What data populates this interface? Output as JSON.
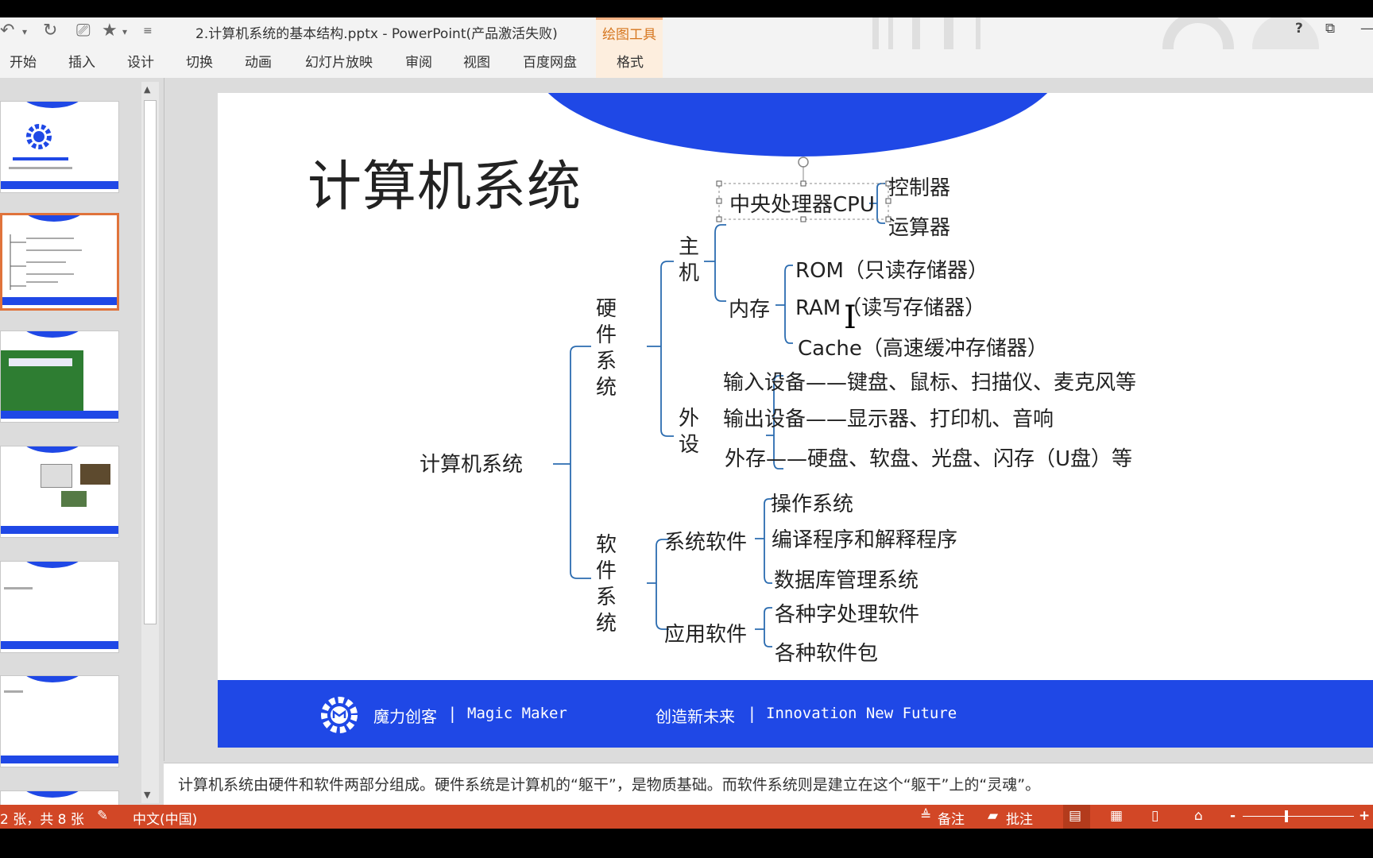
{
  "window": {
    "title": "2.计算机系统的基本结构.pptx - PowerPoint(产品激活失败)",
    "contextual_group": "绘图工具",
    "help": "?"
  },
  "ribbon": {
    "tabs": [
      "开始",
      "插入",
      "设计",
      "切换",
      "动画",
      "幻灯片放映",
      "审阅",
      "视图",
      "百度网盘"
    ],
    "contextual_tab": "格式"
  },
  "slide": {
    "title": "计算机系统",
    "tree": {
      "root": "计算机系统",
      "hardware": "硬件系统",
      "host": "主机",
      "cpu": "中央处理器CPU",
      "controller": "控制器",
      "alu": "运算器",
      "memory": "内存",
      "rom": "ROM（只读存储器）",
      "ram": "RAM（读写存储器）",
      "cache": "Cache（高速缓冲存储器）",
      "peripheral": "外设",
      "input": "输入设备——键盘、鼠标、扫描仪、麦克风等",
      "output": "输出设备——显示器、打印机、音响",
      "storage": "外存——硬盘、软盘、光盘、闪存（U盘）等",
      "software": "软件系统",
      "system_software": "系统软件",
      "os": "操作系统",
      "compiler": "编译程序和解释程序",
      "dbms": "数据库管理系统",
      "application_software": "应用软件",
      "word_processing": "各种字处理软件",
      "packages": "各种软件包"
    },
    "footer": {
      "brand_cn": "魔力创客",
      "brand_en": "Magic Maker",
      "slogan_cn": "创造新未来",
      "slogan_en": "Innovation New Future",
      "sep": "|"
    }
  },
  "notes": "计算机系统由硬件和软件两部分组成。硬件系统是计算机的“躯干”，是物质基础。而软件系统则是建立在这个“躯干”上的“灵魂”。",
  "statusbar": {
    "slide_counter": "2 张，共 8 张",
    "language": "中文(中国)",
    "notes_btn": "备注",
    "comments_btn": "批注",
    "zoom_minus": "-",
    "zoom_plus": "+"
  },
  "colors": {
    "accent_blue": "#1f48e6",
    "status_orange": "#d24726",
    "contextual_orange": "#d6761e"
  }
}
